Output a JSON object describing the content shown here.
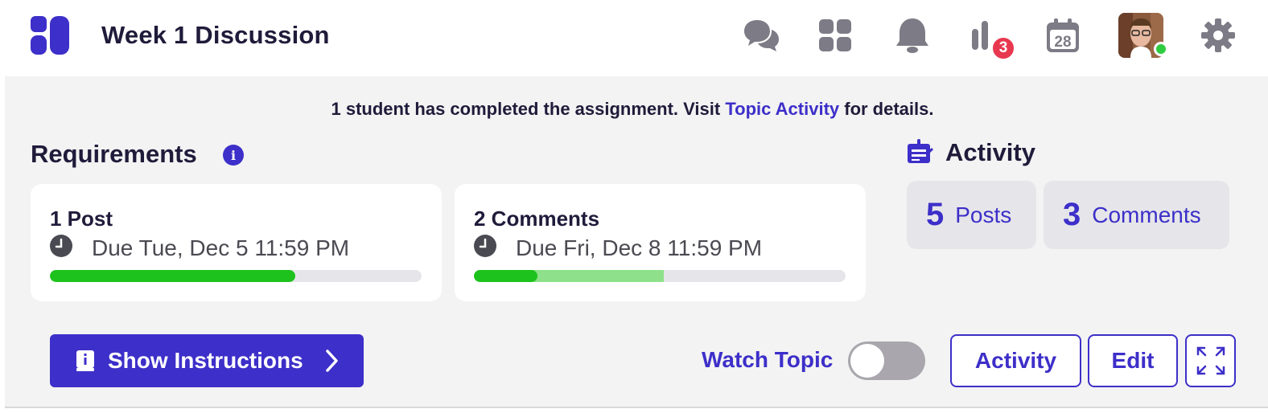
{
  "header": {
    "title": "Week 1 Discussion",
    "icons": [
      "app-logo",
      "chat-icon",
      "apps-grid-icon",
      "bell-icon",
      "stats-icon",
      "calendar-icon",
      "avatar",
      "gear-icon"
    ],
    "stats_badge": "3",
    "calendar_day": "28"
  },
  "notice": {
    "prefix": "1 student has completed the assignment. Visit ",
    "link": "Topic Activity",
    "suffix": " for details."
  },
  "requirements": {
    "title": "Requirements",
    "info_glyph": "i",
    "cards": [
      {
        "title": "1 Post",
        "due": "Due Tue, Dec 5 11:59 PM",
        "progress": 0.66,
        "progress_partial": 0
      },
      {
        "title": "2 Comments",
        "due": "Due Fri, Dec 8 11:59 PM",
        "progress": 0.17,
        "progress_partial": 0.34
      }
    ]
  },
  "activity": {
    "title": "Activity",
    "posts_count": "5",
    "posts_label": "Posts",
    "comments_count": "3",
    "comments_label": "Comments"
  },
  "actions": {
    "show_instructions": "Show Instructions",
    "watch_topic": "Watch Topic",
    "watch_enabled": false,
    "activity_button": "Activity",
    "edit_button": "Edit"
  },
  "colors": {
    "accent": "#3d2fc9",
    "progress_complete": "#1dc21d",
    "progress_partial": "#8fe08a",
    "badge": "#e8384f",
    "icon_gray": "#7d7b85"
  }
}
